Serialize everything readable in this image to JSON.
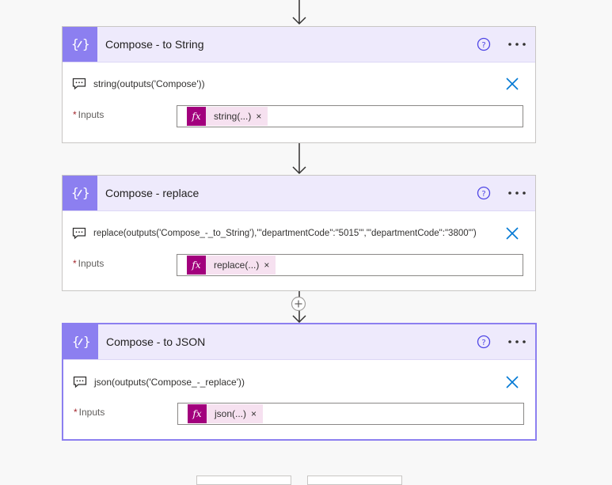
{
  "colors": {
    "accent": "#8c7ff0",
    "header_bg": "#eeeafc",
    "fx_token": "#a2007d",
    "close_icon": "#0078d4"
  },
  "cards": [
    {
      "title": "Compose - to String",
      "comment": "string(outputs('Compose'))",
      "inputs_label": "Inputs",
      "required_mark": "*",
      "token_label": "string(...)",
      "token_icon": "fx",
      "token_remove": "×"
    },
    {
      "title": "Compose - replace",
      "comment": "replace(outputs('Compose_-_to_String'),'\"departmentCode\":\"5015\"','\"departmentCode\":\"3800\"')",
      "inputs_label": "Inputs",
      "required_mark": "*",
      "token_label": "replace(...)",
      "token_icon": "fx",
      "token_remove": "×"
    },
    {
      "title": "Compose - to JSON",
      "comment": "json(outputs('Compose_-_replace'))",
      "inputs_label": "Inputs",
      "required_mark": "*",
      "token_label": "json(...)",
      "token_icon": "fx",
      "token_remove": "×"
    }
  ]
}
